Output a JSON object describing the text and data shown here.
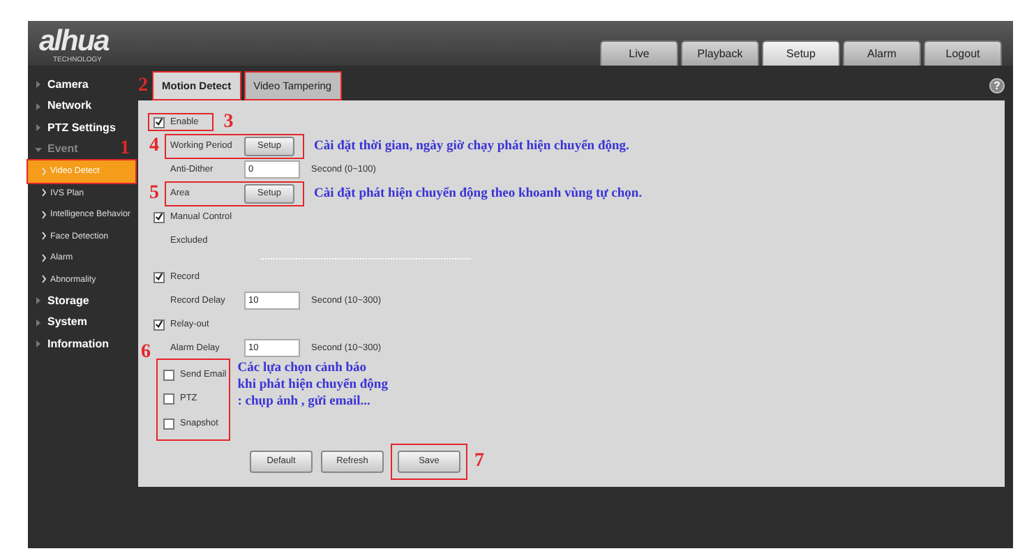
{
  "logo": {
    "text": "alhua",
    "subtitle": "TECHNOLOGY"
  },
  "top_tabs": [
    {
      "label": "Live",
      "selected": false
    },
    {
      "label": "Playback",
      "selected": false
    },
    {
      "label": "Setup",
      "selected": true
    },
    {
      "label": "Alarm",
      "selected": false
    },
    {
      "label": "Logout",
      "selected": false
    }
  ],
  "sidebar": {
    "items": [
      {
        "label": "Camera",
        "expanded": false
      },
      {
        "label": "Network",
        "expanded": false
      },
      {
        "label": "PTZ Settings",
        "expanded": false
      },
      {
        "label": "Event",
        "expanded": true,
        "annotation": "1",
        "children": [
          {
            "label": "Video Detect",
            "selected": true,
            "highlighted": true
          },
          {
            "label": "IVS Plan",
            "selected": false
          },
          {
            "label": "Intelligence Behavior",
            "selected": false
          },
          {
            "label": "Face Detection",
            "selected": false
          },
          {
            "label": "Alarm",
            "selected": false
          },
          {
            "label": "Abnormality",
            "selected": false
          }
        ]
      },
      {
        "label": "Storage",
        "expanded": false
      },
      {
        "label": "System",
        "expanded": false
      },
      {
        "label": "Information",
        "expanded": false
      }
    ]
  },
  "tabs": {
    "annotation": "2",
    "highlighted": true,
    "items": [
      {
        "label": "Motion Detect",
        "selected": true
      },
      {
        "label": "Video Tampering",
        "selected": false
      }
    ]
  },
  "help": "?",
  "form": [
    {
      "kind": "checkbox",
      "label": "Enable",
      "checked": true,
      "highlighted": true,
      "annotation": "3"
    },
    {
      "kind": "button",
      "label": "Working Period",
      "button": "Setup",
      "highlighted": true,
      "annotation": "4",
      "note": "Cài đặt thời gian, ngày giờ chạy phát hiện chuyển động."
    },
    {
      "kind": "input",
      "label": "Anti-Dither",
      "value": "0",
      "unit": "Second (0~100)"
    },
    {
      "kind": "button",
      "label": "Area",
      "button": "Setup",
      "highlighted": true,
      "annotation": "5",
      "note": "Cài đặt phát hiện chuyển động theo khoanh vùng tự chọn."
    },
    {
      "kind": "checkbox",
      "label": "Manual Control",
      "checked": true
    },
    {
      "kind": "text",
      "label": "Excluded"
    },
    {
      "kind": "divider"
    },
    {
      "kind": "checkbox",
      "label": "Record",
      "checked": true
    },
    {
      "kind": "input",
      "label": "Record Delay",
      "value": "10",
      "unit": "Second (10~300)"
    },
    {
      "kind": "checkbox",
      "label": "Relay-out",
      "checked": true
    },
    {
      "kind": "input",
      "label": "Alarm Delay",
      "value": "10",
      "unit": "Second (10~300)"
    },
    {
      "kind": "group",
      "highlighted": true,
      "annotation": "6",
      "note": "Các lựa chọn cảnh báo\nkhi phát hiện chuyển động\n: chụp ảnh , gửi email...",
      "items": [
        {
          "label": "Send Email",
          "checked": false
        },
        {
          "label": "PTZ",
          "checked": false
        },
        {
          "label": "Snapshot",
          "checked": false
        }
      ]
    }
  ],
  "buttons": [
    {
      "label": "Default"
    },
    {
      "label": "Refresh"
    },
    {
      "label": "Save",
      "highlighted": true,
      "annotation": "7"
    }
  ]
}
